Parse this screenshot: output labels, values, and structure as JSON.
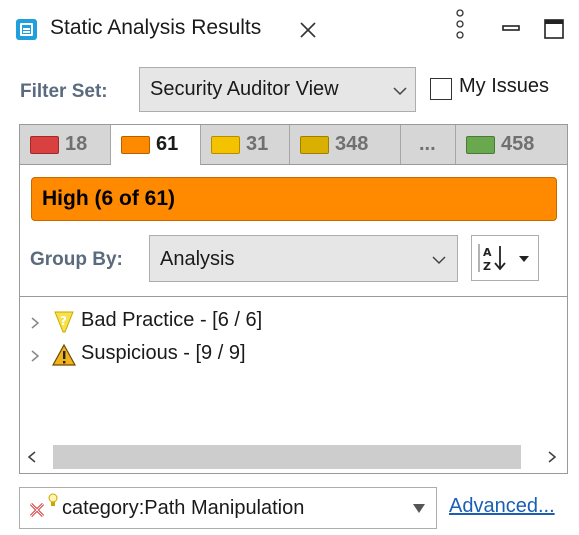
{
  "window": {
    "title": "Static Analysis Results",
    "icon": "static-analysis-icon",
    "controls": [
      "close-tab-icon",
      "view-menu-icon",
      "minimize-icon",
      "maximize-icon"
    ]
  },
  "filter_set": {
    "label": "Filter Set:",
    "selected": "Security Auditor View",
    "my_issues_label": "My Issues",
    "my_issues_checked": false
  },
  "priority_tabs": [
    {
      "color": "#d94040",
      "count": "18",
      "active": false
    },
    {
      "color": "#ff8a00",
      "count": "61",
      "active": true
    },
    {
      "color": "#f5c200",
      "count": "31",
      "active": false
    },
    {
      "color": "#d9b000",
      "count": "348",
      "active": false
    },
    {
      "label": "...",
      "active": false
    },
    {
      "color": "#6aa84f",
      "count": "458",
      "active": false
    }
  ],
  "selected_folder": {
    "label": "High (6 of 61)",
    "color": "#ff8a00"
  },
  "group_by": {
    "label": "Group By:",
    "selected": "Analysis",
    "sort_icon": "sort-az-icon"
  },
  "tree": [
    {
      "label": "Bad Practice - [6 / 6]",
      "icon": "question-bulb-icon",
      "expanded": false
    },
    {
      "label": "Suspicious - [9 / 9]",
      "icon": "warning-icon",
      "expanded": false
    }
  ],
  "search_filter": {
    "value": "category:Path Manipulation",
    "icon": "clear-filter-icon"
  },
  "advanced_link": "Advanced..."
}
